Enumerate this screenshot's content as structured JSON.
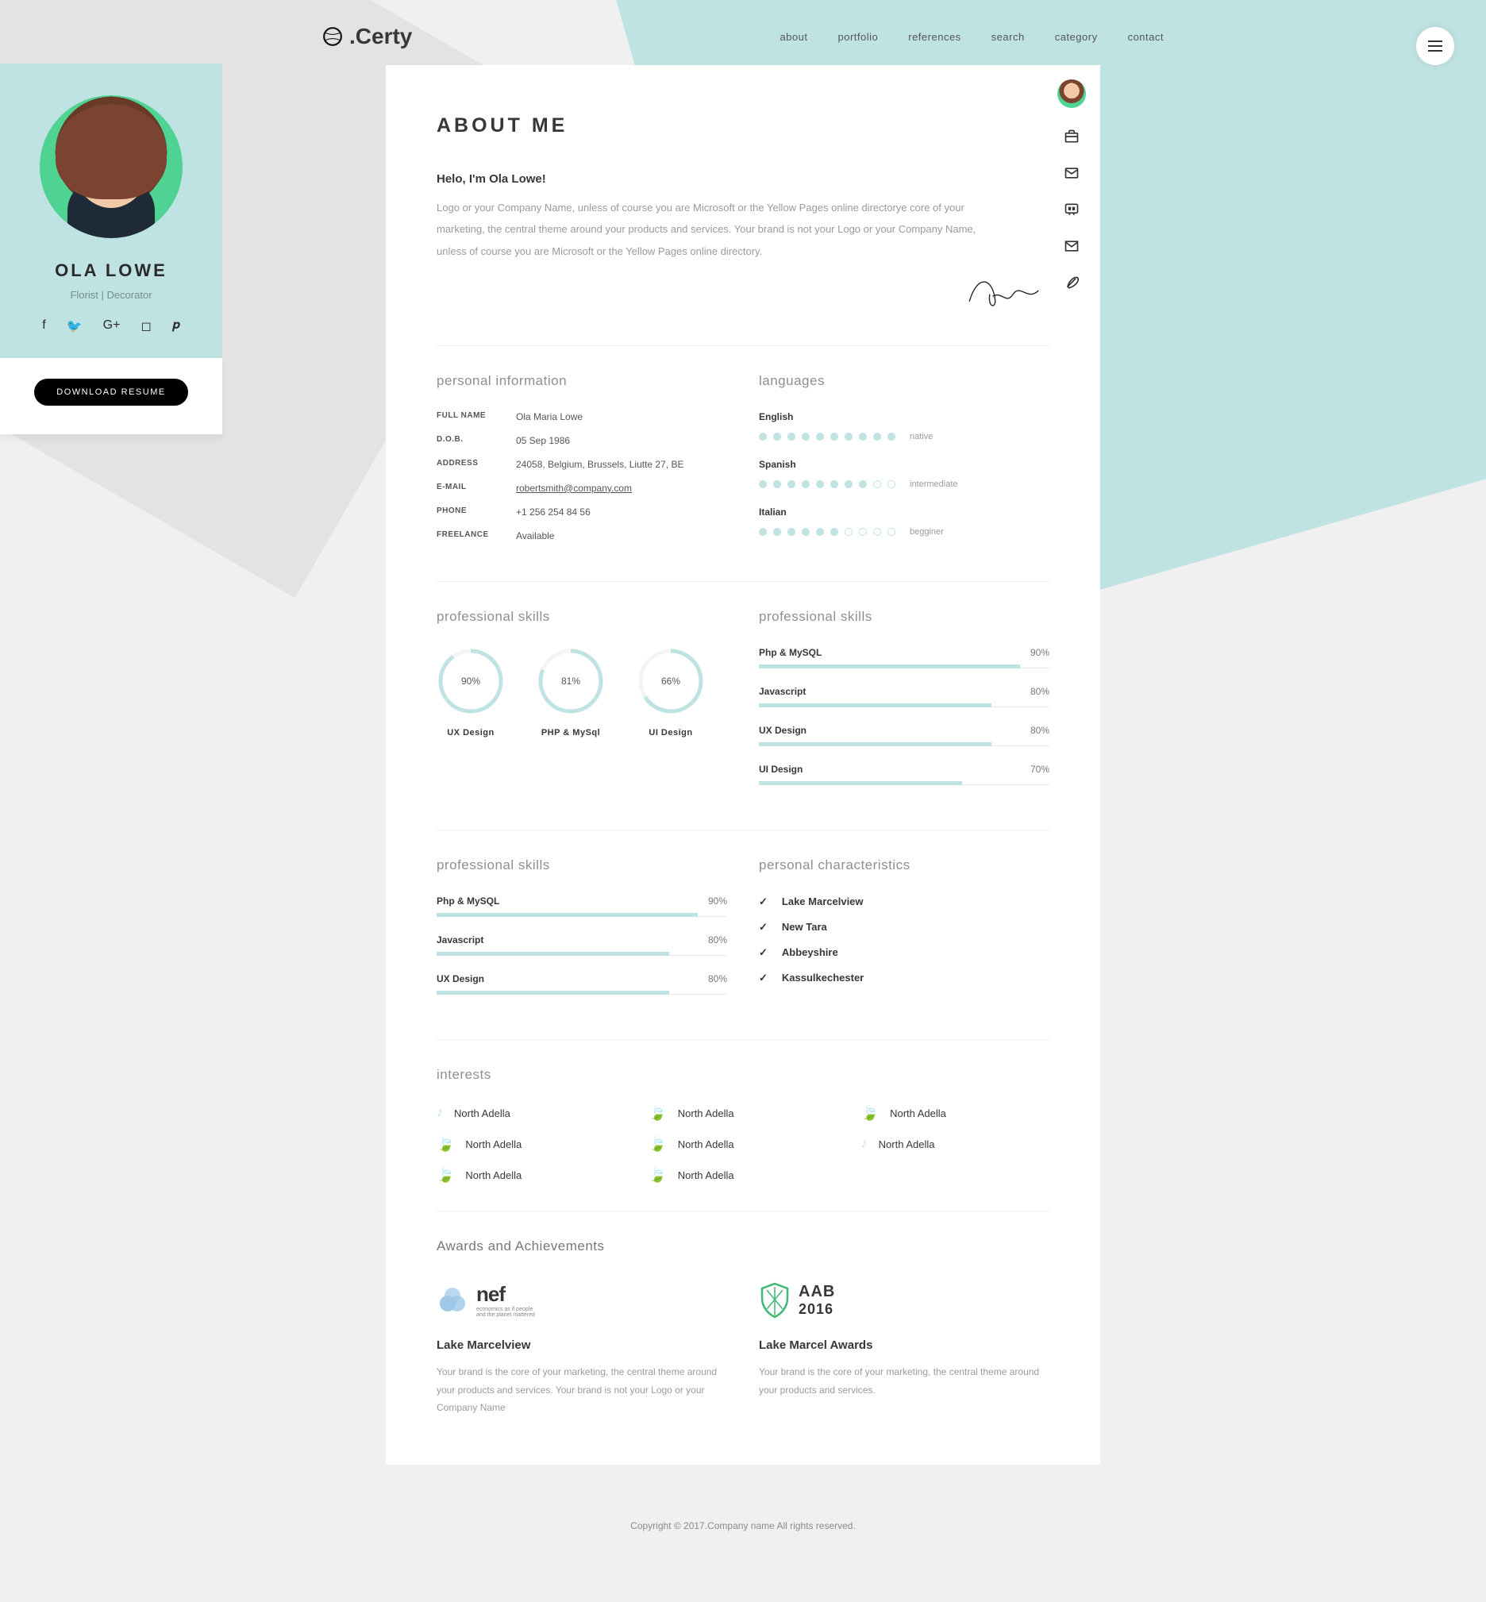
{
  "brand": ".Certy",
  "nav": [
    "about",
    "portfolio",
    "references",
    "search",
    "category",
    "contact"
  ],
  "profile": {
    "name": "OLA LOWE",
    "role": "Florist | Decorator",
    "download_label": "DOWNLOAD RESUME"
  },
  "about": {
    "title": "ABOUT ME",
    "greeting": "Helo, I'm Ola Lowe!",
    "body": "Logo or your Company Name, unless of course you are Microsoft or the Yellow Pages online directorye core of your marketing, the central theme around your products and services. Your brand is not your Logo or your Company Name, unless of course you are Microsoft or the Yellow Pages online directory."
  },
  "personal": {
    "heading": "personal information",
    "rows": [
      {
        "k": "FULL NAME",
        "v": "Ola Maria Lowe"
      },
      {
        "k": "D.O.B.",
        "v": "05 Sep 1986"
      },
      {
        "k": "ADDRESS",
        "v": "24058, Belgium, Brussels, Liutte 27, BE"
      },
      {
        "k": "E-MAIL",
        "v": "robertsmith@company.com",
        "link": true
      },
      {
        "k": "PHONE",
        "v": "+1 256 254 84 56"
      },
      {
        "k": "FREELANCE",
        "v": "Available"
      }
    ]
  },
  "languages": {
    "heading": "languages",
    "items": [
      {
        "name": "English",
        "filled": 10,
        "total": 10,
        "level": "native"
      },
      {
        "name": "Spanish",
        "filled": 8,
        "total": 10,
        "level": "intermediate"
      },
      {
        "name": "Italian",
        "filled": 6,
        "total": 10,
        "level": "begginer"
      }
    ]
  },
  "circle_skills": {
    "heading": "professional skills",
    "items": [
      {
        "label": "UX Design",
        "pct": 90
      },
      {
        "label": "PHP & MySql",
        "pct": 81
      },
      {
        "label": "UI Design",
        "pct": 66
      }
    ]
  },
  "bar_skills_a": {
    "heading": "professional skills",
    "items": [
      {
        "name": "Php & MySQL",
        "pct": 90
      },
      {
        "name": "Javascript",
        "pct": 80
      },
      {
        "name": "UX Design",
        "pct": 80
      },
      {
        "name": "UI Design",
        "pct": 70
      }
    ]
  },
  "bar_skills_b": {
    "heading": "professional skills",
    "items": [
      {
        "name": "Php & MySQL",
        "pct": 90
      },
      {
        "name": "Javascript",
        "pct": 80
      },
      {
        "name": "UX Design",
        "pct": 80
      }
    ]
  },
  "characteristics": {
    "heading": "personal characteristics",
    "items": [
      "Lake Marcelview",
      "New Tara",
      "Abbeyshire",
      "Kassulkechester"
    ]
  },
  "interests": {
    "heading": "interests",
    "items": [
      {
        "icon": "music",
        "label": "North Adella"
      },
      {
        "icon": "leaf",
        "label": "North Adella"
      },
      {
        "icon": "leaf",
        "label": "North Adella"
      },
      {
        "icon": "leaf",
        "label": "North Adella"
      },
      {
        "icon": "leaf",
        "label": "North Adella"
      },
      {
        "icon": "music",
        "label": "North Adella"
      },
      {
        "icon": "leaf",
        "label": "North Adella"
      },
      {
        "icon": "leaf",
        "label": "North Adella"
      }
    ]
  },
  "awards": {
    "heading": "Awards and Achievements",
    "items": [
      {
        "logo": "nef",
        "title": "Lake Marcelview",
        "text": "Your brand is the core of your marketing, the central theme around your products and services. Your brand is not your Logo or your Company Name"
      },
      {
        "logo": "aab",
        "title": "Lake Marcel Awards",
        "text": "Your brand is the core of your marketing, the central theme around your products and services."
      }
    ]
  },
  "footer": "Copyright © 2017.Company name All rights reserved."
}
